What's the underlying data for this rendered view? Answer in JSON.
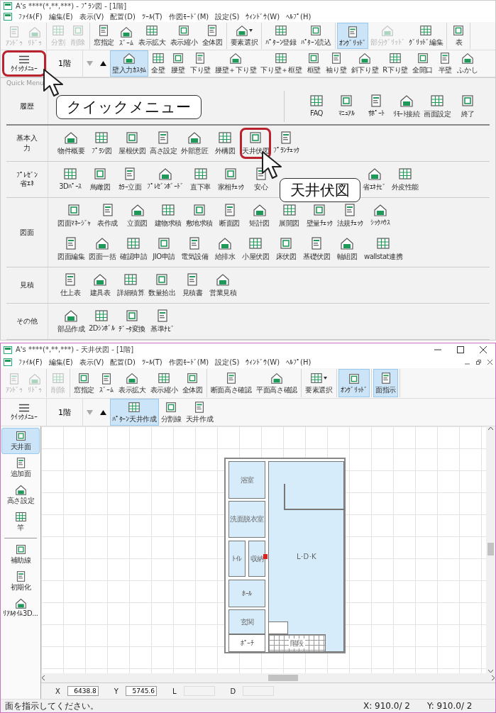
{
  "plan_window": {
    "title": "A's ****(*,**,***) - ﾌﾟﾗﾝ図 - [1階]",
    "menu": [
      "ﾌｧｲﾙ(F)",
      "編集(E)",
      "表示(V)",
      "配置(D)",
      "ﾂｰﾙ(T)",
      "作図ﾓｰﾄﾞ(M)",
      "設定(S)",
      "ｳｨﾝﾄﾞｳ(W)",
      "ﾍﾙﾌﾟ(H)"
    ],
    "toolbar": [
      [
        {
          "label": "ｱﾝﾄﾞｩ",
          "disabled": true,
          "selected": false,
          "dropdown": false
        },
        {
          "label": "ﾘﾄﾞｩ",
          "disabled": true,
          "selected": false,
          "dropdown": false
        }
      ],
      [
        {
          "label": "分割",
          "disabled": true,
          "selected": false,
          "dropdown": false
        },
        {
          "label": "削除",
          "disabled": true,
          "selected": false,
          "dropdown": false
        }
      ],
      [
        {
          "label": "窓指定",
          "disabled": false,
          "selected": false,
          "dropdown": false
        },
        {
          "label": "ｽﾞｰﾑ",
          "disabled": false,
          "selected": false,
          "dropdown": false
        },
        {
          "label": "表示拡大",
          "disabled": false,
          "selected": false,
          "dropdown": false
        },
        {
          "label": "表示縮小",
          "disabled": false,
          "selected": false,
          "dropdown": false
        },
        {
          "label": "全体図",
          "disabled": false,
          "selected": false,
          "dropdown": false
        }
      ],
      [
        {
          "label": "要素選択",
          "disabled": false,
          "selected": false,
          "dropdown": true
        }
      ],
      [
        {
          "label": "ﾊﾟﾀｰﾝ登録",
          "disabled": false,
          "selected": false,
          "dropdown": false
        },
        {
          "label": "ﾊﾟﾀｰﾝ読込",
          "disabled": false,
          "selected": false,
          "dropdown": false
        }
      ],
      [
        {
          "label": "ｵﾝｸﾞﾘｯﾄﾞ",
          "disabled": false,
          "selected": true,
          "dropdown": false
        },
        {
          "label": "部分ｸﾞﾘｯﾄﾞ",
          "disabled": true,
          "selected": false,
          "dropdown": false
        },
        {
          "label": "ｸﾞﾘｯﾄﾞ編集",
          "disabled": false,
          "selected": false,
          "dropdown": false
        }
      ],
      [
        {
          "label": "表",
          "disabled": false,
          "selected": false,
          "dropdown": false
        }
      ]
    ],
    "quick_menu": {
      "label": "ｸｲｯｸﾒﾆｭｰ",
      "highlighted": true
    },
    "floor": "1階",
    "floor_down": {
      "disabled": true
    },
    "floor_up": {
      "disabled": false
    },
    "tools": [
      {
        "label": "壁入力ｶｽﾀﾑ",
        "selected": true
      },
      {
        "label": "全壁",
        "selected": false
      },
      {
        "label": "腰壁",
        "selected": false
      },
      {
        "label": "下り壁",
        "selected": false
      },
      {
        "label": "腰壁＋下り壁",
        "selected": false
      },
      {
        "label": "下り壁＋框壁",
        "selected": false
      },
      {
        "label": "框壁",
        "selected": false
      },
      {
        "label": "袖り壁",
        "selected": false
      },
      {
        "label": "斜下り壁",
        "selected": false
      },
      {
        "label": "R下り壁",
        "selected": false
      },
      {
        "label": "全開口",
        "selected": false
      },
      {
        "label": "半壁",
        "selected": false
      },
      {
        "label": "ふかし",
        "selected": false
      }
    ],
    "panel": {
      "title": "Quick Menu",
      "sections": [
        {
          "label": "履歴",
          "side_items": [
            {
              "label": "FAQ",
              "highlighted": false
            },
            {
              "label": "ﾏﾆｭｱﾙ",
              "highlighted": false
            },
            {
              "label": "ｻﾎﾟｰﾄ",
              "highlighted": false
            },
            {
              "label": "ﾘﾓｰﾄ接続",
              "highlighted": false
            },
            {
              "label": "画面設定",
              "highlighted": false
            },
            {
              "label": "終了",
              "highlighted": false
            }
          ]
        },
        {
          "label": "基本入力",
          "rows": [
            [
              {
                "label": "物件概要",
                "highlighted": false
              },
              {
                "label": "ﾌﾟﾗﾝ図",
                "highlighted": false
              },
              {
                "label": "屋根伏図",
                "highlighted": false
              },
              {
                "label": "高さ設定",
                "highlighted": false
              },
              {
                "label": "外部意匠",
                "highlighted": false
              },
              {
                "label": "外構図",
                "highlighted": false
              },
              {
                "label": "天井伏図",
                "highlighted": true
              },
              {
                "label": "ﾌﾟﾗﾝﾁｪｯｸ",
                "highlighted": false
              }
            ]
          ]
        },
        {
          "label": "ﾌﾟﾚｾﾞﾝ",
          "sub_label": "省ｴﾈ",
          "rows": [
            [
              {
                "label": "3Dﾊﾟｰｽ",
                "highlighted": false
              },
              {
                "label": "鳥瞰図",
                "highlighted": false
              },
              {
                "label": "ｶﾗｰ立面",
                "highlighted": false
              },
              {
                "label": "ﾌﾟﾚｾﾞﾝﾎﾞｰﾄﾞ",
                "highlighted": false
              },
              {
                "label": "直下率",
                "highlighted": false
              },
              {
                "label": "家相ﾁｪｯｸ",
                "highlighted": false
              },
              {
                "label": "安心",
                "highlighted": false
              },
              {
                "label": "省ｴﾈﾅﾋﾞ",
                "highlighted": false
              },
              {
                "label": "外皮性能",
                "highlighted": false
              }
            ]
          ]
        },
        {
          "label": "図面",
          "rows": [
            [
              {
                "label": "図面ﾏﾈｰｼﾞｬ",
                "highlighted": false
              },
              {
                "label": "表作成",
                "highlighted": false
              },
              {
                "label": "立面図",
                "highlighted": false
              },
              {
                "label": "建物求積",
                "highlighted": false
              },
              {
                "label": "敷地求積",
                "highlighted": false
              },
              {
                "label": "断面図",
                "highlighted": false
              },
              {
                "label": "矩計図",
                "highlighted": false
              },
              {
                "label": "展開図",
                "highlighted": false
              },
              {
                "label": "壁量ﾁｪｯｸ",
                "highlighted": false
              },
              {
                "label": "法規ﾁｪｯｸ",
                "highlighted": false
              },
              {
                "label": "ｼｯｸﾊｳｽ",
                "highlighted": false
              }
            ],
            [
              {
                "label": "図面編集",
                "highlighted": false
              },
              {
                "label": "図面一括",
                "highlighted": false
              },
              {
                "label": "確認申請",
                "highlighted": false
              },
              {
                "label": "JIO申請",
                "highlighted": false
              },
              {
                "label": "電気設備",
                "highlighted": false
              },
              {
                "label": "給排水",
                "highlighted": false
              },
              {
                "label": "小屋伏図",
                "highlighted": false
              },
              {
                "label": "床伏図",
                "highlighted": false
              },
              {
                "label": "基礎伏図",
                "highlighted": false
              },
              {
                "label": "軸組図",
                "highlighted": false
              },
              {
                "label": "wallstat連携",
                "highlighted": false
              }
            ]
          ]
        },
        {
          "label": "見積",
          "rows": [
            [
              {
                "label": "仕上表",
                "highlighted": false
              },
              {
                "label": "建具表",
                "highlighted": false
              },
              {
                "label": "詳細積算",
                "highlighted": false
              },
              {
                "label": "数量拾出",
                "highlighted": false
              },
              {
                "label": "見積書",
                "highlighted": false
              },
              {
                "label": "営業見積",
                "highlighted": false
              }
            ]
          ]
        },
        {
          "label": "その他",
          "rows": [
            [
              {
                "label": "部品作成",
                "highlighted": false
              },
              {
                "label": "2Dｼﾝﾎﾞﾙ",
                "highlighted": false
              },
              {
                "label": "ﾃﾞｰﾀ変換",
                "highlighted": false
              },
              {
                "label": "基準ﾅﾋﾞ",
                "highlighted": false
              }
            ]
          ]
        }
      ]
    },
    "callouts": [
      {
        "text": "クイックメニュー"
      },
      {
        "text": "天井伏図"
      }
    ]
  },
  "ceiling_window": {
    "title": "A's ****(*,**,***) - 天井伏図 - [1階]",
    "menu": [
      "ﾌｧｲﾙ(F)",
      "編集(E)",
      "表示(V)",
      "配置(D)",
      "ﾂｰﾙ(T)",
      "作図ﾓｰﾄﾞ(M)",
      "設定(S)",
      "ｳｨﾝﾄﾞｳ(W)",
      "ﾍﾙﾌﾟ(H)"
    ],
    "toolbar": [
      [
        {
          "label": "ｱﾝﾄﾞｩ",
          "disabled": true,
          "selected": false,
          "dropdown": false
        },
        {
          "label": "ﾘﾄﾞｩ",
          "disabled": true,
          "selected": false,
          "dropdown": false
        }
      ],
      [
        {
          "label": "削除",
          "disabled": true,
          "selected": false,
          "dropdown": false
        }
      ],
      [
        {
          "label": "窓指定",
          "disabled": false,
          "selected": false,
          "dropdown": false
        },
        {
          "label": "ｽﾞｰﾑ",
          "disabled": false,
          "selected": false,
          "dropdown": false
        },
        {
          "label": "表示拡大",
          "disabled": false,
          "selected": false,
          "dropdown": false
        },
        {
          "label": "表示縮小",
          "disabled": false,
          "selected": false,
          "dropdown": false
        },
        {
          "label": "全体図",
          "disabled": false,
          "selected": false,
          "dropdown": false
        }
      ],
      [
        {
          "label": "断面高さ確認",
          "disabled": false,
          "selected": false,
          "dropdown": false
        },
        {
          "label": "平面高さ確認",
          "disabled": false,
          "selected": false,
          "dropdown": false
        }
      ],
      [
        {
          "label": "要素選択",
          "disabled": false,
          "selected": false,
          "dropdown": true
        }
      ],
      [
        {
          "label": "ｵﾝｸﾞﾘｯﾄﾞ",
          "disabled": false,
          "selected": true,
          "dropdown": false
        }
      ],
      [
        {
          "label": "面指示",
          "disabled": false,
          "selected": true,
          "dropdown": false
        }
      ]
    ],
    "quick_menu": {
      "label": "ｸｲｯｸﾒﾆｭｰ",
      "highlighted": false
    },
    "floor": "1階",
    "floor_down": {
      "disabled": true
    },
    "floor_up": {
      "disabled": false
    },
    "tools": [
      {
        "label": "ﾊﾟﾀｰﾝ天井作成",
        "selected": true
      },
      {
        "label": "分割線",
        "selected": false
      },
      {
        "label": "天井作成",
        "selected": false
      }
    ],
    "side_tools": [
      {
        "label": "天井面",
        "selected": true
      },
      {
        "label": "追加面",
        "selected": false
      },
      {
        "label": "高さ設定",
        "selected": false
      },
      {
        "label": "竿",
        "selected": false
      },
      {
        "label": "補助線",
        "selected": false
      },
      {
        "label": "初期化",
        "selected": false
      },
      {
        "label": "ﾘｱﾙﾀｲﾑ3D...",
        "selected": false
      }
    ],
    "rooms": [
      {
        "label": "浴室",
        "kind": "ceiling"
      },
      {
        "label": "洗面脱衣室",
        "kind": "ceiling"
      },
      {
        "label": "ﾄｲﾚ",
        "kind": "ceiling"
      },
      {
        "label": "収納",
        "kind": "ceiling"
      },
      {
        "label": "ﾎｰﾙ",
        "kind": "ceiling"
      },
      {
        "label": "玄関",
        "kind": "ceiling"
      },
      {
        "label": "ﾎﾟｰﾁ",
        "kind": "open"
      },
      {
        "label": "L･D･K",
        "kind": "ceiling"
      },
      {
        "label": "階段",
        "kind": "stair"
      }
    ],
    "coords": [
      {
        "label": "X",
        "value": "6438.8",
        "disabled": false
      },
      {
        "label": "Y",
        "value": "5745.6",
        "disabled": false
      },
      {
        "label": "L",
        "disabled": true
      },
      {
        "label": "D",
        "disabled": true
      }
    ],
    "status": {
      "message": "面を指示してください。",
      "x": "X: 910.0/ 2",
      "y": "Y: 910.0/ 2"
    }
  }
}
